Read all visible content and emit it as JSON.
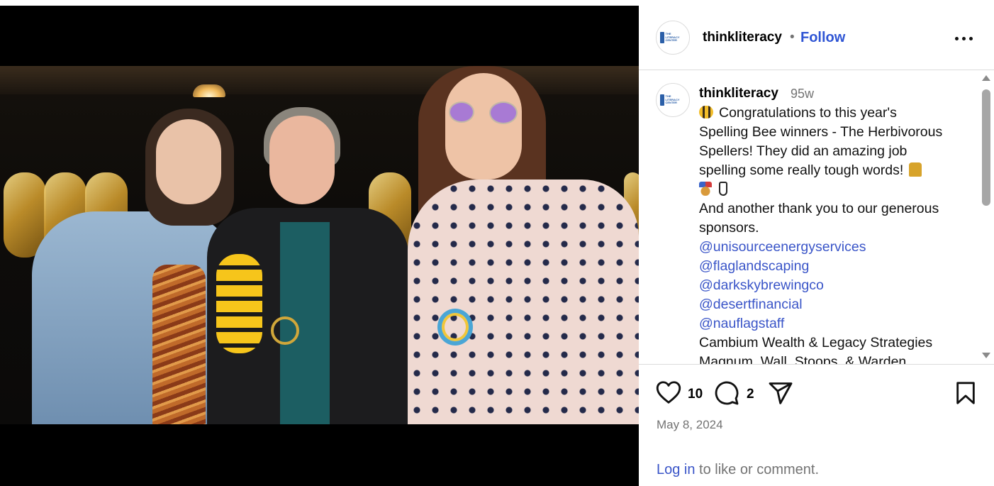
{
  "post": {
    "username": "thinkliteracy",
    "dot": "•",
    "follow_label": "Follow",
    "avatar_text": "THE LITERACY CENTER",
    "more_icon": "more-horizontal-icon",
    "caption": {
      "username": "thinkliteracy",
      "time": "95w",
      "line1": "Congratulations to this year's",
      "line2": "Spelling Bee winners - The Herbivorous",
      "line3": "Spellers! They did an amazing job",
      "line4": "spelling some really tough words!",
      "line6": "And another thank you to our generous",
      "line7": "sponsors.",
      "mentions": [
        "@unisourceenergyservices",
        "@flaglandscaping",
        "@darkskybrewingco",
        "@desertfinancial",
        "@nauflagstaff"
      ],
      "line13": "Cambium Wealth & Legacy Strategies",
      "line14": "Magnum, Wall, Stoops, & Warden"
    },
    "likes": "10",
    "comments": "2",
    "date": "May 8, 2024",
    "login_link": "Log in",
    "login_rest": " to like or comment."
  },
  "colors": {
    "link": "#3a55c8",
    "follow": "#2f55d4",
    "muted": "#737373",
    "divider": "#dbdbdb"
  },
  "icons": [
    "heart-icon",
    "comment-icon",
    "share-icon",
    "bookmark-icon",
    "bee-emoji",
    "trophy-emoji",
    "medal-emoji"
  ]
}
